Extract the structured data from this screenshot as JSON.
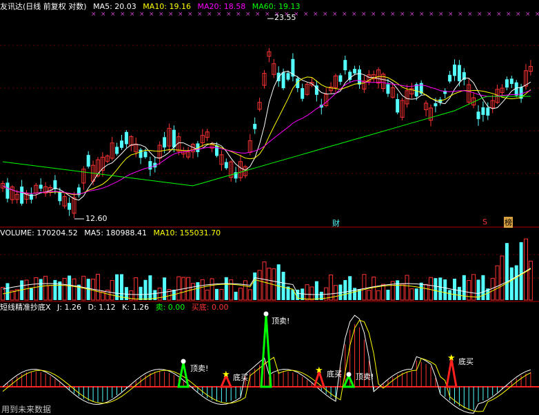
{
  "price_panel": {
    "title": "友讯达(日线 前复权 对数)",
    "ma5": "MA5: 20.03",
    "ma10": "MA10: 19.16",
    "ma20": "MA20: 18.58",
    "ma60": "MA60: 19.13",
    "high_label": "23.55",
    "low_label": "12.60",
    "markers": {
      "cai": "财",
      "s": "S",
      "bang": "榜"
    },
    "colors": {
      "up": "#ff3333",
      "down": "#54ffff",
      "ma5": "#ffffff",
      "ma10": "#ffff00",
      "ma20": "#ff00ff",
      "ma60": "#00ff00"
    }
  },
  "volume_panel": {
    "title": "VOLUME: 170204.52",
    "ma5": "MA5: 180988.41",
    "ma10": "MA10: 155031.70"
  },
  "indicator_panel": {
    "title": "短线精准抄底X",
    "j": "J: 1.26",
    "d": "D: 1.12",
    "k": "K: 1.26",
    "sell": "卖: 0.00",
    "buy": "买底: 0.00",
    "signals": [
      {
        "text": "顶卖!",
        "type": "sell"
      },
      {
        "text": "底买",
        "type": "buy"
      },
      {
        "text": "顶卖!",
        "type": "sell"
      },
      {
        "text": "底买",
        "type": "buy"
      },
      {
        "text": "顶卖!",
        "type": "sell"
      },
      {
        "text": "底买",
        "type": "buy"
      }
    ]
  },
  "footer": {
    "text": "用到未来数据"
  }
}
